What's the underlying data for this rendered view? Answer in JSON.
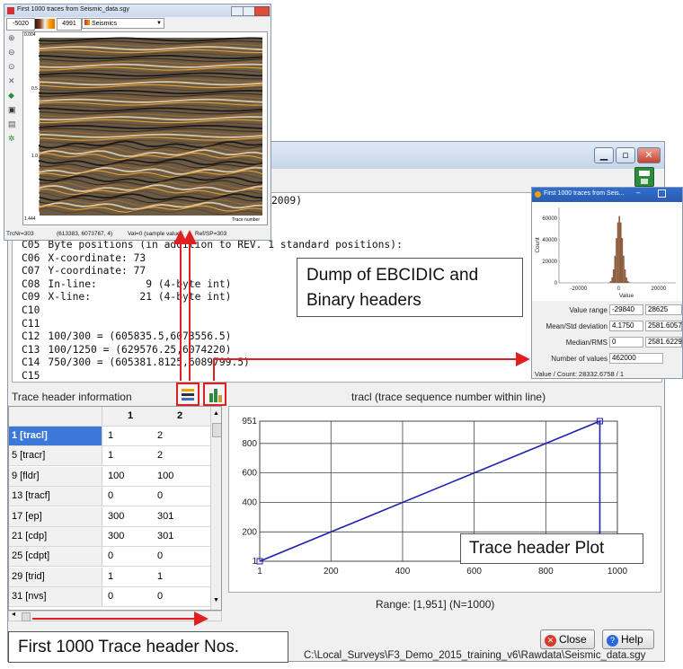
{
  "seismic_window": {
    "title": "First 1000 traces from Seismic_data.sgy",
    "colorbar_min": "-5020",
    "colorbar_max": "4991",
    "colortable": "Seismics",
    "y_ticks": [
      "0.004",
      "0.5",
      "1.0",
      "1.444"
    ],
    "x_axis_label": "Trace number",
    "status": {
      "trc": "TrcNr=303",
      "coords": "(613383, 6073767, 4)",
      "val": "Val=0 (sample value);",
      "ref": "Ref/SP=303"
    }
  },
  "header_dump": {
    "partial_first_line": "2009)",
    "lines": [
      {
        "code": "C05",
        "text": "Byte positions (in addition to REV. 1 standard positions):"
      },
      {
        "code": "C06",
        "text": "X-coordinate: 73"
      },
      {
        "code": "C07",
        "text": "Y-coordinate: 77"
      },
      {
        "code": "C08",
        "text": "In-line:        9 (4-byte int)"
      },
      {
        "code": "C09",
        "text": "X-line:        21 (4-byte int)"
      },
      {
        "code": "C10",
        "text": ""
      },
      {
        "code": "C11",
        "text": ""
      },
      {
        "code": "C12",
        "text": "100/300 = (605835.5,6073556.5)"
      },
      {
        "code": "C13",
        "text": "100/1250 = (629576.25,6074220)"
      },
      {
        "code": "C14",
        "text": "750/300 = (605381.8125,6089799.5)"
      },
      {
        "code": "C15",
        "text": ""
      }
    ]
  },
  "trace_header": {
    "label": "Trace header information",
    "plot_title": "tracl (trace sequence number within line)",
    "columns": [
      "1",
      "2"
    ],
    "rows": [
      {
        "name": "1 [tracl]",
        "v1": "1",
        "v2": "2"
      },
      {
        "name": "5 [tracr]",
        "v1": "1",
        "v2": "2"
      },
      {
        "name": "9 [fldr]",
        "v1": "100",
        "v2": "100"
      },
      {
        "name": "13 [tracf]",
        "v1": "0",
        "v2": "0"
      },
      {
        "name": "17 [ep]",
        "v1": "300",
        "v2": "301"
      },
      {
        "name": "21 [cdp]",
        "v1": "300",
        "v2": "301"
      },
      {
        "name": "25 [cdpt]",
        "v1": "0",
        "v2": "0"
      },
      {
        "name": "29 [trid]",
        "v1": "1",
        "v2": "1"
      },
      {
        "name": "31 [nvs]",
        "v1": "0",
        "v2": "0"
      }
    ],
    "range_text": "Range: [1,951] (N=1000)"
  },
  "chart_data": [
    {
      "type": "line",
      "title": "tracl (trace sequence number within line)",
      "x_ticks": [
        "1",
        "200",
        "400",
        "600",
        "800",
        "1000"
      ],
      "y_ticks": [
        "951",
        "800",
        "600",
        "400",
        "200",
        "1"
      ],
      "xlim": [
        1,
        1000
      ],
      "ylim": [
        1,
        951
      ],
      "series": [
        {
          "points": [
            [
              1,
              1
            ],
            [
              951,
              951
            ],
            [
              951,
              1
            ],
            [
              1000,
              1
            ]
          ]
        }
      ],
      "color": "#1f1fb0"
    },
    {
      "type": "bar",
      "xlabel": "Value",
      "ylabel": "Count",
      "y_ticks": [
        "60000",
        "40000",
        "20000",
        "0"
      ],
      "x_ticks": [
        "-20000",
        "0",
        "20000"
      ],
      "xlim": [
        -29840,
        28625
      ],
      "ylim": [
        0,
        70000
      ],
      "color": "#8b5a3c"
    }
  ],
  "histogram_window": {
    "title": "First 1000 traces from Seis...",
    "stats": [
      {
        "label": "Value range",
        "a": "-29840",
        "b": "28625"
      },
      {
        "label": "Mean/Std deviation",
        "a": "4.1750",
        "b": "2581.6057"
      },
      {
        "label": "Median/RMS",
        "a": "0",
        "b": "2581.6229"
      },
      {
        "label": "Number of values",
        "a": "462000",
        "b": ""
      }
    ],
    "value_count": "Value / Count:  28332.6758 / 1"
  },
  "buttons": {
    "close": "Close",
    "help": "Help"
  },
  "file_path": "C:\\Local_Surveys\\F3_Demo_2015_training_v6\\Rawdata\\Seismic_data.sgy",
  "annotations": {
    "dump": [
      "Dump of EBCIDIC and",
      "Binary headers"
    ],
    "plot": "Trace header Plot",
    "nos": "First 1000 Trace header Nos."
  },
  "colors": {
    "accent_red": "#e02020",
    "plot_line": "#1f1fb0"
  }
}
